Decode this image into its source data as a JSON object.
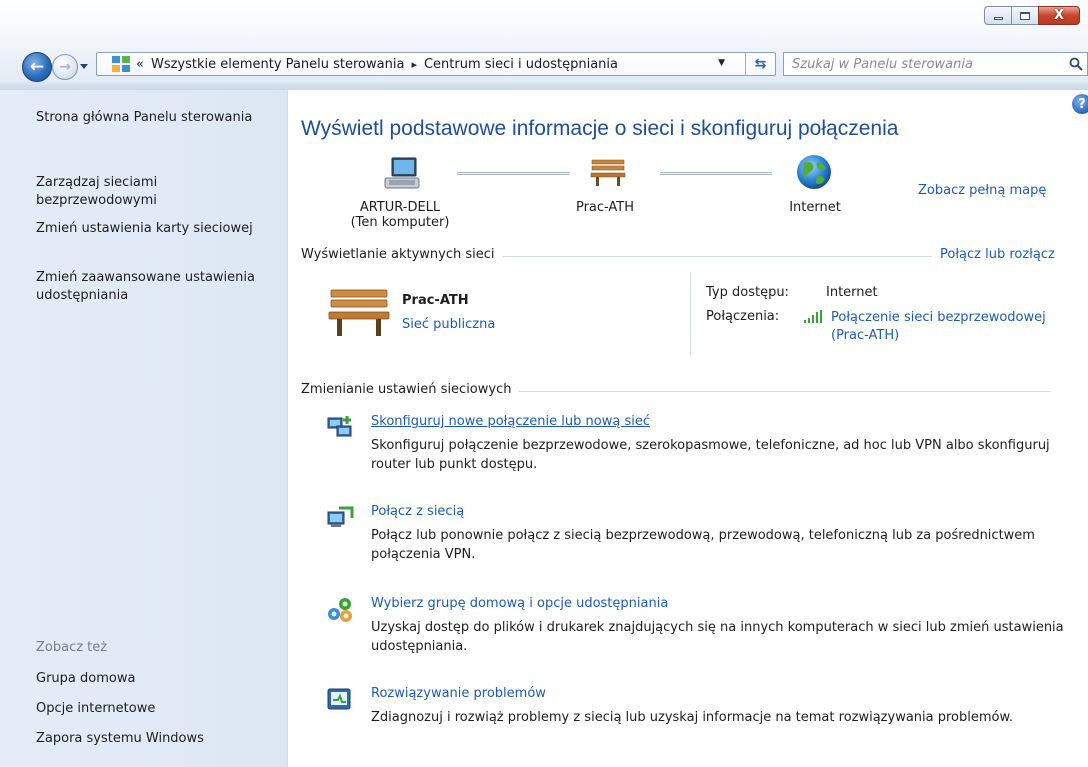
{
  "window": {
    "controls": {
      "minimize": "minimize",
      "maximize": "maximize",
      "close": "X"
    }
  },
  "address_bar": {
    "overflow_glyph": "«",
    "breadcrumbs": [
      "Wszystkie elementy Panelu sterowania",
      "Centrum sieci i udostępniania"
    ],
    "separator": "▸"
  },
  "search": {
    "placeholder": "Szukaj w Panelu sterowania"
  },
  "left_pane": {
    "links": [
      "Strona główna Panelu sterowania",
      "Zarządzaj sieciami bezprzewodowymi",
      "Zmień ustawienia karty sieciowej",
      "Zmień zaawansowane ustawienia udostępniania"
    ],
    "see_also_label": "Zobacz też",
    "see_also_links": [
      "Grupa domowa",
      "Opcje internetowe",
      "Zapora systemu Windows"
    ]
  },
  "main": {
    "title": "Wyświetl podstawowe informacje o sieci i skonfiguruj połączenia",
    "full_map_link": "Zobacz pełną mapę",
    "map": {
      "computer_name": "ARTUR-DELL",
      "computer_sub": "(Ten komputer)",
      "network": "Prac-ATH",
      "internet": "Internet"
    },
    "active_networks": {
      "section_title": "Wyświetlanie aktywnych sieci",
      "connect_link": "Połącz lub rozłącz",
      "network_name": "Prac-ATH",
      "network_type": "Sieć publiczna",
      "access_type_label": "Typ dostępu:",
      "access_type_value": "Internet",
      "connections_label": "Połączenia:",
      "connections_value": "Połączenie sieci bezprzewodowej (Prac-ATH)"
    },
    "change_settings": {
      "section_title": "Zmienianie ustawień sieciowych",
      "tasks": [
        {
          "icon": "network-setup-icon",
          "title": "Skonfiguruj nowe połączenie lub nową sieć",
          "description": "Skonfiguruj połączenie bezprzewodowe, szerokopasmowe, telefoniczne, ad hoc lub VPN albo skonfiguruj router lub punkt dostępu."
        },
        {
          "icon": "network-connect-icon",
          "title": "Połącz z siecią",
          "description": "Połącz lub ponownie połącz z siecią bezprzewodową, przewodową, telefoniczną lub za pośrednictwem połączenia VPN."
        },
        {
          "icon": "homegroup-icon",
          "title": "Wybierz grupę domową i opcje udostępniania",
          "description": "Uzyskaj dostęp do plików i drukarek znajdujących się na innych komputerach w sieci lub zmień ustawienia udostępniania."
        },
        {
          "icon": "troubleshoot-icon",
          "title": "Rozwiązywanie problemów",
          "description": "Zdiagnozuj i rozwiąż problemy z siecią lub uzyskaj informacje na temat rozwiązywania problemów."
        }
      ]
    }
  },
  "colors": {
    "link": "#1a5cb0",
    "title": "#1e4f93",
    "left_pane_bg": "#e4ecf7",
    "left_link": "#1a3d7c"
  }
}
